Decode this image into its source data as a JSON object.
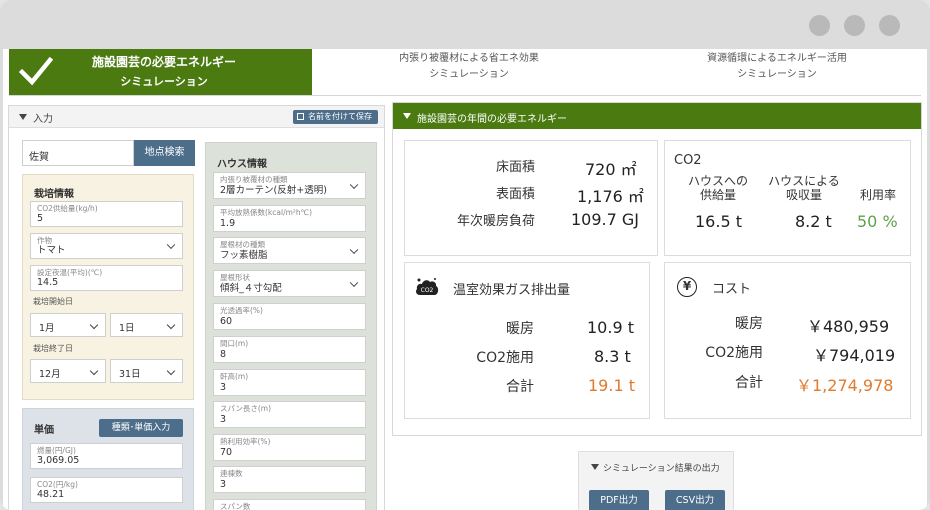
{
  "tabs": {
    "active_line1": "施設園芸の必要エネルギー",
    "active_line2": "シミュレーション",
    "tab2_line1": "内張り被覆材による省エネ効果",
    "tab2_line2": "シミュレーション",
    "tab3_line1": "資源循環によるエネルギー活用",
    "tab3_line2": "シミュレーション"
  },
  "input_panel": {
    "title": "入力",
    "save_button": "名前を付けて保存",
    "location_value": "佐賀",
    "location_search_button": "地点検索",
    "cultivation": {
      "title": "栽培情報",
      "co2_label": "CO2供給量(kg/h)",
      "co2_value": "5",
      "crop_label": "作物",
      "crop_value": "トマト",
      "temp_label": "設定夜温(平均)(℃)",
      "temp_value": "14.5",
      "start_label": "栽培開始日",
      "start_month": "1月",
      "start_day": "1日",
      "end_label": "栽培終了日",
      "end_month": "12月",
      "end_day": "31日"
    },
    "price": {
      "title": "単価",
      "button": "種類･単価入力",
      "fuel_label": "燃量(円/GJ)",
      "fuel_value": "3,069.05",
      "co2_label": "CO2(円/kg)",
      "co2_value": "48.21"
    },
    "house": {
      "title": "ハウス情報",
      "cover_label": "内張り被覆材の種類",
      "cover_value": "2層カーテン(反射+透明)",
      "heat_label": "平均放熱係数(kcal/m²h℃)",
      "heat_value": "1.9",
      "roof_material_label": "屋根材の種類",
      "roof_material_value": "フッ素樹脂",
      "roof_shape_label": "屋根形状",
      "roof_shape_value": "傾斜_４寸勾配",
      "light_label": "光透過率(%)",
      "light_value": "60",
      "frontage_label": "間口(m)",
      "frontage_value": "8",
      "eave_label": "軒高(m)",
      "eave_value": "3",
      "span_length_label": "スパン長さ(m)",
      "span_length_value": "3",
      "heater_label": "熱利用効率(%)",
      "heater_value": "70",
      "bays_label": "連棟数",
      "bays_value": "3",
      "spans_label": "スパン数"
    }
  },
  "result_panel": {
    "title": "施設園芸の年間の必要エネルギー",
    "area": {
      "floor_label": "床面積",
      "floor_value": "720 ㎡",
      "surface_label": "表面積",
      "surface_value": "1,176 ㎡",
      "heating_label": "年次暖房負荷",
      "heating_value": "109.7 GJ"
    },
    "co2": {
      "title": "CO2",
      "supply_label": "ハウスへの\n供給量",
      "absorb_label": "ハウスによる\n吸収量",
      "rate_label": "利用率",
      "supply_value": "16.5 t",
      "absorb_value": "8.2 t",
      "rate_value": "50 %"
    },
    "ghg": {
      "title": "温室効果ガス排出量",
      "icon": "co2-cloud-icon",
      "heating_label": "暖房",
      "heating_value": "10.9 t",
      "co2_label": "CO2施用",
      "co2_value": "8.3 t",
      "total_label": "合計",
      "total_value": "19.1 t"
    },
    "cost": {
      "title": "コスト",
      "icon": "yen-icon",
      "heating_label": "暖房",
      "heating_value": "￥480,959",
      "co2_label": "CO2施用",
      "co2_value": "￥794,019",
      "total_label": "合計",
      "total_value": "￥1,274,978"
    }
  },
  "export": {
    "title": "シミュレーション結果の出力",
    "pdf_button": "PDF出力",
    "csv_button": "CSV出力"
  },
  "colors": {
    "brand_green": "#4a7a10",
    "button_blue": "#4d6e8a",
    "total_orange": "#e07a2c",
    "rate_green": "#5fa14a"
  }
}
